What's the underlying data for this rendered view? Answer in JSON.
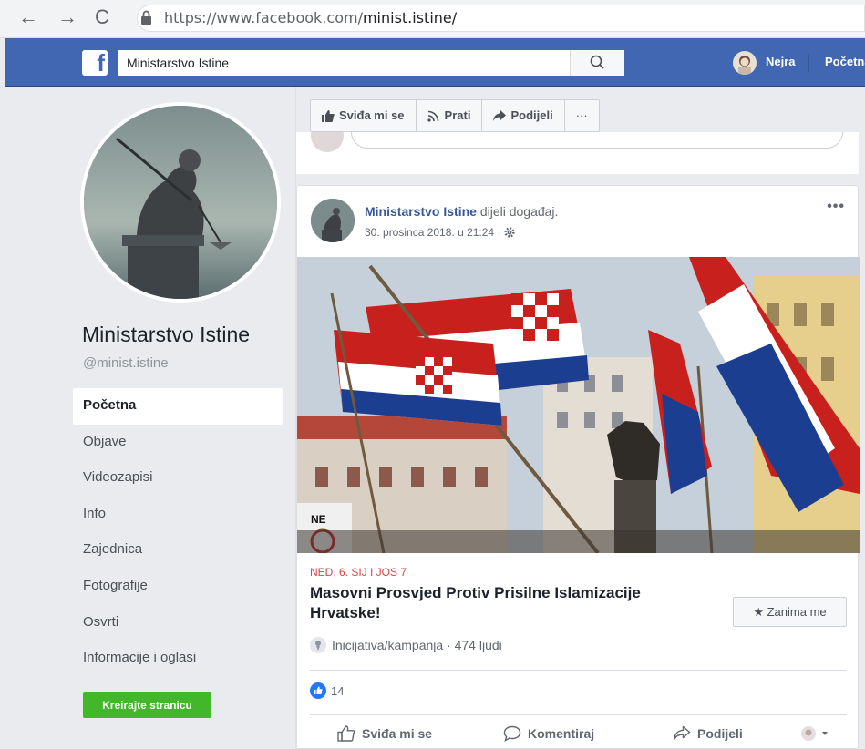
{
  "browser": {
    "url_host": "https://www.facebook.com/",
    "url_path": "minist.istine/"
  },
  "header": {
    "logo": "f",
    "search_value": "Ministarstvo Istine",
    "user_name": "Nejra",
    "home_label": "Početna"
  },
  "page": {
    "name": "Ministarstvo Istine",
    "handle": "@minist.istine"
  },
  "sidebar": {
    "items": [
      {
        "label": "Početna"
      },
      {
        "label": "Objave"
      },
      {
        "label": "Videozapisi"
      },
      {
        "label": "Info"
      },
      {
        "label": "Zajednica"
      },
      {
        "label": "Fotografije"
      },
      {
        "label": "Osvrti"
      },
      {
        "label": "Informacije i oglasi"
      }
    ],
    "create_label": "Kreirajte stranicu"
  },
  "actions": {
    "like": "Sviđa mi se",
    "follow": "Prati",
    "share": "Podijeli",
    "more": "···"
  },
  "post": {
    "author": "Ministarstvo Istine",
    "verb": "dijeli događaj.",
    "date": "30. prosinca 2018. u 21:24 ·",
    "more": "•••",
    "event_date": "NED, 6. SIJ I JOS 7",
    "event_title": "Masovni Prosvjed Protiv Prisilne Islamizacije Hrvatske!",
    "interest_label": "★ Zanima me",
    "event_meta": "Inicijativa/kampanja · 474 ljudi",
    "like_count": "14",
    "like_label": "Sviđa mi se",
    "comment_label": "Komentiraj",
    "share_label": "Podijeli"
  },
  "colors": {
    "fb_blue": "#4267b2",
    "create_green": "#42b72a",
    "event_red": "#d84646"
  }
}
